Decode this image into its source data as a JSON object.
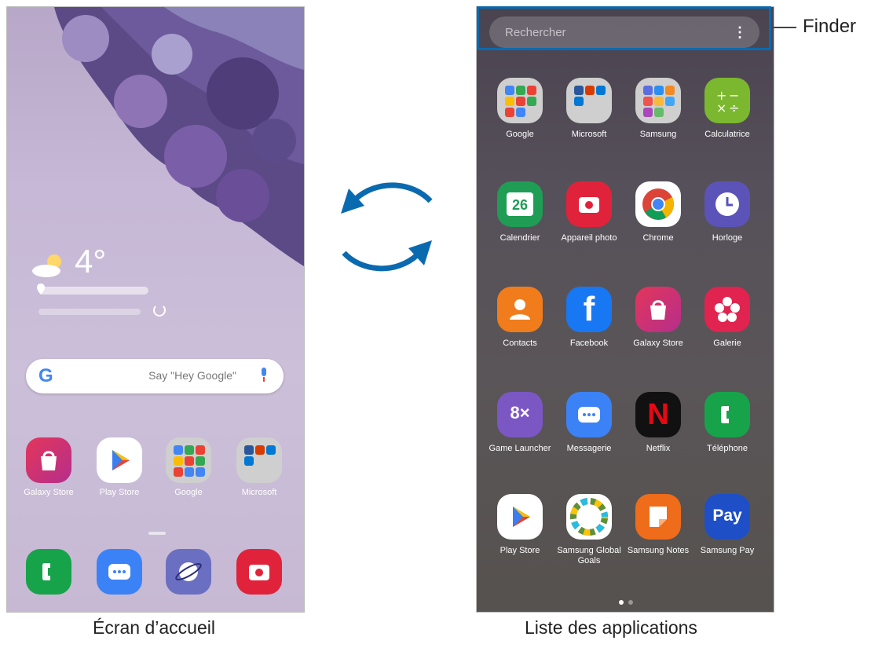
{
  "home_screen": {
    "weather": {
      "temperature": "4°"
    },
    "google_bar": {
      "logo": "G",
      "hint": "Say \"Hey Google\""
    },
    "apps": [
      {
        "label": "Galaxy Store",
        "icon": "galaxy-store-icon"
      },
      {
        "label": "Play Store",
        "icon": "play-store-icon"
      },
      {
        "label": "Google",
        "icon": "google-folder-icon"
      },
      {
        "label": "Microsoft",
        "icon": "microsoft-folder-icon"
      }
    ],
    "dock": [
      {
        "icon": "phone-icon"
      },
      {
        "icon": "messages-icon"
      },
      {
        "icon": "internet-icon"
      },
      {
        "icon": "camera-icon"
      }
    ],
    "caption": "Écran d’accueil"
  },
  "apps_screen": {
    "search": {
      "placeholder": "Rechercher",
      "more": "⋮"
    },
    "apps": [
      {
        "label": "Google",
        "icon": "google-folder-icon"
      },
      {
        "label": "Microsoft",
        "icon": "microsoft-folder-icon"
      },
      {
        "label": "Samsung",
        "icon": "samsung-folder-icon"
      },
      {
        "label": "Calculatrice",
        "icon": "calculator-icon"
      },
      {
        "label": "Calendrier",
        "icon": "calendar-icon",
        "badge": "26"
      },
      {
        "label": "Appareil photo",
        "icon": "camera-icon"
      },
      {
        "label": "Chrome",
        "icon": "chrome-icon"
      },
      {
        "label": "Horloge",
        "icon": "clock-icon"
      },
      {
        "label": "Contacts",
        "icon": "contacts-icon"
      },
      {
        "label": "Facebook",
        "icon": "facebook-icon",
        "badge": "f"
      },
      {
        "label": "Galaxy Store",
        "icon": "galaxy-store-icon"
      },
      {
        "label": "Galerie",
        "icon": "gallery-icon"
      },
      {
        "label": "Game Launcher",
        "icon": "game-launcher-icon",
        "badge": "8×"
      },
      {
        "label": "Messagerie",
        "icon": "messages-icon"
      },
      {
        "label": "Netflix",
        "icon": "netflix-icon",
        "badge": "N"
      },
      {
        "label": "Téléphone",
        "icon": "phone-icon"
      },
      {
        "label": "Play Store",
        "icon": "play-store-icon"
      },
      {
        "label": "Samsung Global Goals",
        "icon": "global-goals-icon"
      },
      {
        "label": "Samsung Notes",
        "icon": "notes-icon"
      },
      {
        "label": "Samsung Pay",
        "icon": "samsung-pay-icon",
        "badge": "Pay"
      }
    ],
    "caption": "Liste des applications"
  },
  "callout": {
    "label": "Finder"
  },
  "colors": {
    "accent": "#0a6ab0"
  }
}
